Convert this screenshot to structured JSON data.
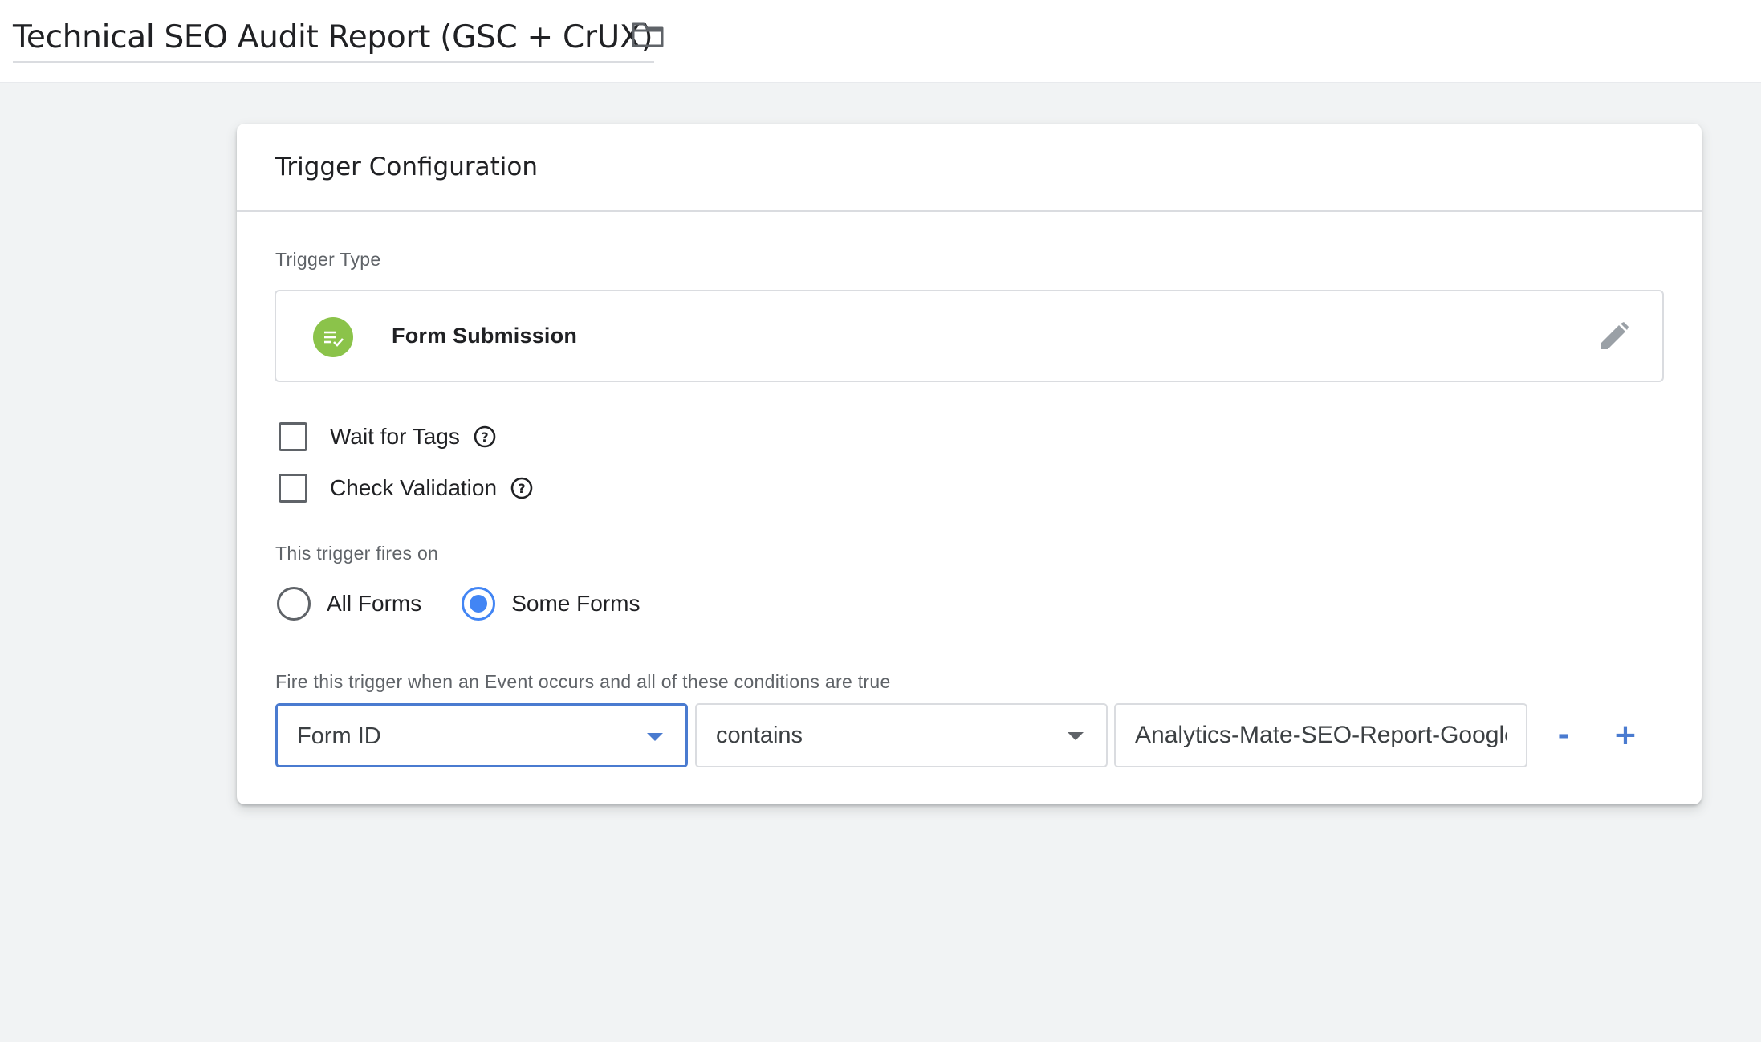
{
  "header": {
    "title": "Technical SEO Audit Report (GSC + CrUX)",
    "folder_icon": "folder-icon"
  },
  "card": {
    "title": "Trigger Configuration",
    "trigger_type": {
      "label": "Trigger Type",
      "name": "Form Submission",
      "icon": "form-submission-icon",
      "icon_color": "#8bc34a",
      "edit_icon": "pencil-icon"
    },
    "options": {
      "wait_for_tags": {
        "label": "Wait for Tags",
        "checked": false
      },
      "check_validation": {
        "label": "Check Validation",
        "checked": false
      }
    },
    "fires_on": {
      "label": "This trigger fires on",
      "options": [
        {
          "label": "All Forms",
          "selected": false
        },
        {
          "label": "Some Forms",
          "selected": true
        }
      ]
    },
    "condition": {
      "label": "Fire this trigger when an Event occurs and all of these conditions are true",
      "variable": "Form ID",
      "operator": "contains",
      "value": "Analytics-Mate-SEO-Report-Google",
      "remove_label": "-",
      "add_label": "+"
    }
  },
  "colors": {
    "accent": "#4285f4",
    "focus_border": "#4a7bd0",
    "background": "#f1f3f4"
  }
}
